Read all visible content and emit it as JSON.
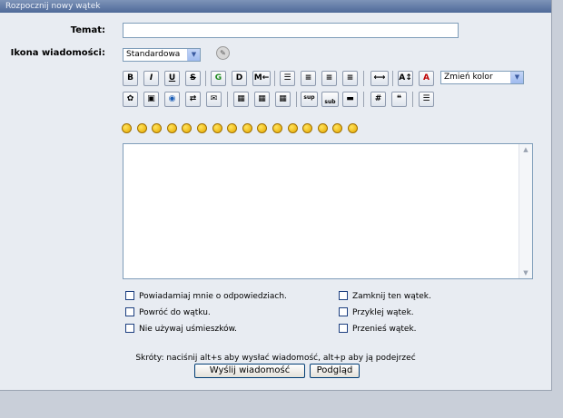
{
  "panel": {
    "title": "Rozpocznij nowy wątek"
  },
  "form": {
    "subject_label": "Temat:",
    "subject_value": "",
    "icon_label": "Ikona wiadomości:",
    "icon_select": "Standardowa"
  },
  "toolbar": {
    "bold": "B",
    "italic": "I",
    "underline": "U",
    "strike": "S",
    "glow": "G",
    "shadow": "D",
    "move": "M",
    "font_color_select": "Zmień kolor",
    "sup": "sup",
    "sub": "sub",
    "hash": "#"
  },
  "editor": {
    "content": ""
  },
  "options": [
    {
      "label": "Powiadamiaj mnie o odpowiedziach."
    },
    {
      "label": "Powróć do wątku."
    },
    {
      "label": "Nie używaj uśmieszków."
    },
    {
      "label": "Zamknij ten wątek."
    },
    {
      "label": "Przyklej wątek."
    },
    {
      "label": "Przenieś wątek."
    }
  ],
  "shortcuts": "Skróty: naciśnij alt+s aby wysłać wiadomość, alt+p aby ją podejrzeć",
  "buttons": {
    "submit": "Wyślij wiadomość",
    "preview": "Podgląd"
  },
  "colors": {
    "title_bar": "#4f6a99",
    "panel": "#e8ecf2",
    "page": "#c9cfd9",
    "smiley": "#ffd21a"
  },
  "smileys": [
    "smiley",
    "wink",
    "cheesy",
    "grin",
    "angry",
    "sad",
    "shocked",
    "cool",
    "huh",
    "roll-eyes",
    "tongue",
    "embarrassed",
    "lips-sealed",
    "undecided",
    "kiss",
    "cry"
  ]
}
